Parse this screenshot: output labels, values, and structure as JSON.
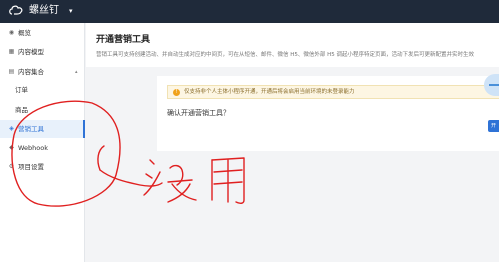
{
  "topbar": {
    "brand": "螺丝钉",
    "caret": "▾"
  },
  "sidebar": {
    "items": [
      {
        "icon": "◉",
        "label": "概览"
      },
      {
        "icon": "▦",
        "label": "内容模型"
      },
      {
        "icon": "▤",
        "label": "内容集合",
        "caret": "▴"
      },
      {
        "label": "订单"
      },
      {
        "label": "商品"
      },
      {
        "icon": "◈",
        "label": "营销工具"
      },
      {
        "icon": "◆",
        "label": "Webhook"
      },
      {
        "icon": "⚙",
        "label": "项目设置"
      }
    ]
  },
  "page": {
    "title": "开通营销工具",
    "description": "营销工具可支持创建活动、并自动生成对应的中间页，可在从短信、邮件、微信 H5、微信外部 H5 调起小程序特定页面，活动下发后可更新配置并实时生效"
  },
  "card": {
    "notice_icon": "!",
    "notice": "仅支持非个人主体小程序开通，开通后将会启用当前环境的未登录能力",
    "confirm": "确认开通营销工具？",
    "button": "开"
  },
  "annotation": {
    "text": "没用"
  },
  "colors": {
    "topbar": "#1f2a3a",
    "accent": "#2f73d6",
    "annotation": "#e02020"
  }
}
